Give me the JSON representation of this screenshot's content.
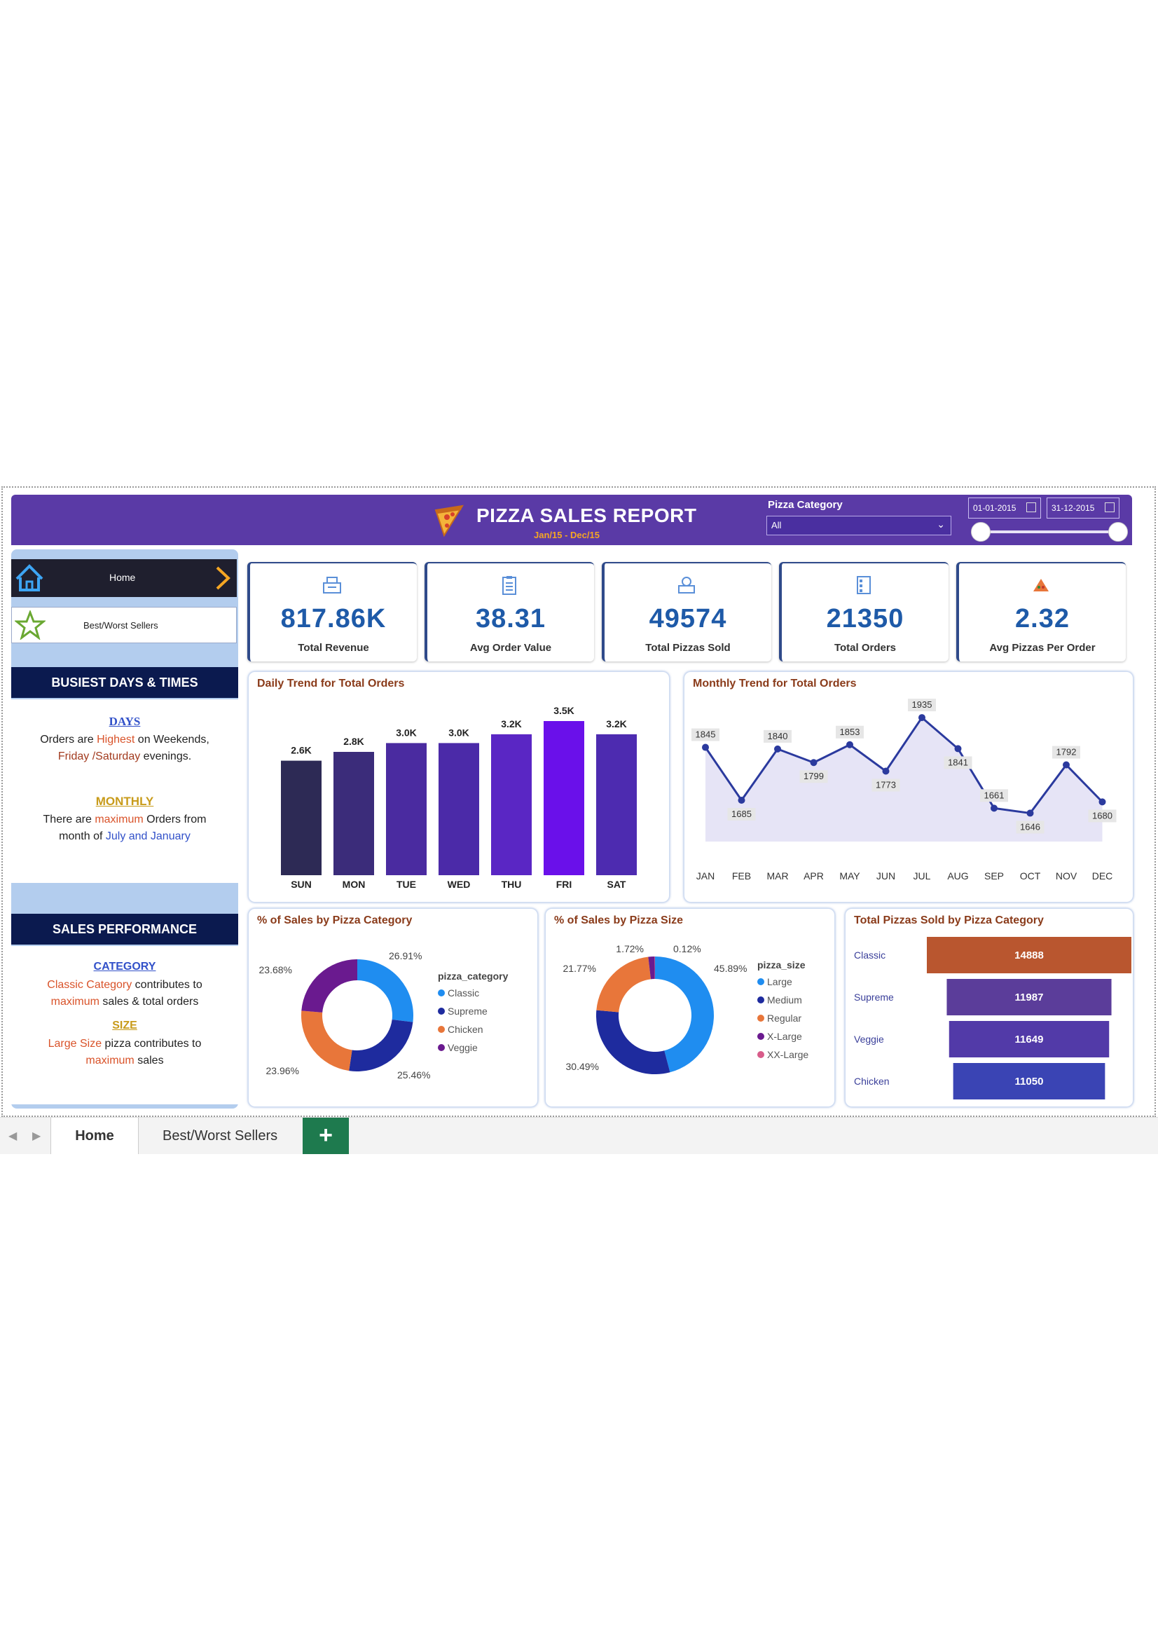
{
  "report": {
    "title": "PIZZA SALES REPORT",
    "subtitle": "Jan/15  -  Dec/15"
  },
  "filters": {
    "category_label": "Pizza Category",
    "category_value": "All",
    "start_date": "01-01-2015",
    "end_date": "31-12-2015"
  },
  "nav": {
    "home": "Home",
    "best_worst": "Best/Worst Sellers"
  },
  "busiest": {
    "heading": "BUSIEST DAYS & TIMES",
    "days_title": "DAYS",
    "days_l1a": "Orders are ",
    "days_l1b": "Highest",
    "days_l1c": " on  Weekends,",
    "days_l2a": "Friday /Saturday",
    "days_l2b": " evenings.",
    "monthly_title": "MONTHLY",
    "monthly_l1a": "There are ",
    "monthly_l1b": "maximum",
    "monthly_l1c": " Orders from",
    "monthly_l2a": "month of ",
    "monthly_l2b": "July and January"
  },
  "performance": {
    "heading": "SALES PERFORMANCE",
    "category_title": "CATEGORY",
    "cat_l1a": "Classic Category",
    "cat_l1b": " contributes to",
    "cat_l2a": "maximum",
    "cat_l2b": " sales & total orders",
    "size_title": "SIZE",
    "size_l1a": "Large Size",
    "size_l1b": " pizza contributes to",
    "size_l2": "maximum",
    "size_l2b": " sales"
  },
  "kpis": [
    {
      "value": "817.86K",
      "label": "Total Revenue"
    },
    {
      "value": "38.31",
      "label": "Avg Order Value"
    },
    {
      "value": "49574",
      "label": "Total Pizzas Sold"
    },
    {
      "value": "21350",
      "label": "Total Orders"
    },
    {
      "value": "2.32",
      "label": "Avg Pizzas Per Order"
    }
  ],
  "colors": {
    "header": "#5a3aa6",
    "accent_orange": "#f5a623",
    "kpi_value": "#1e5aa8",
    "panel_title": "#8a3b1a"
  },
  "chart_data": [
    {
      "type": "bar",
      "title": "Daily Trend for Total Orders",
      "categories": [
        "SUN",
        "MON",
        "TUE",
        "WED",
        "THU",
        "FRI",
        "SAT"
      ],
      "values": [
        2.6,
        2.8,
        3.0,
        3.0,
        3.2,
        3.5,
        3.2
      ],
      "data_labels": [
        "2.6K",
        "2.8K",
        "3.0K",
        "3.0K",
        "3.2K",
        "3.5K",
        "3.2K"
      ],
      "colors": [
        "#2d2a55",
        "#3b2c7a",
        "#4a2ba0",
        "#4b2aa8",
        "#5a26c4",
        "#6a10ea",
        "#4d2bb0"
      ],
      "ylim": [
        0,
        3.5
      ]
    },
    {
      "type": "area",
      "title": "Monthly Trend for Total Orders",
      "categories": [
        "JAN",
        "FEB",
        "MAR",
        "APR",
        "MAY",
        "JUN",
        "JUL",
        "AUG",
        "SEP",
        "OCT",
        "NOV",
        "DEC"
      ],
      "values": [
        1845,
        1685,
        1840,
        1799,
        1853,
        1773,
        1935,
        1841,
        1661,
        1646,
        1792,
        1680
      ],
      "ylim": [
        1560,
        1950
      ]
    },
    {
      "type": "pie",
      "title": "% of Sales by Pizza Category",
      "legend_title": "pizza_category",
      "labels": [
        "Classic",
        "Supreme",
        "Chicken",
        "Veggie"
      ],
      "values": [
        26.91,
        25.46,
        23.96,
        23.68
      ],
      "value_labels": [
        "26.91%",
        "25.46%",
        "23.96%",
        "23.68%"
      ],
      "colors": [
        "#1f8df0",
        "#1e2b9e",
        "#e8763a",
        "#6a1a8f"
      ]
    },
    {
      "type": "pie",
      "title": "% of Sales by Pizza Size",
      "legend_title": "pizza_size",
      "labels": [
        "Large",
        "Medium",
        "Regular",
        "X-Large",
        "XX-Large"
      ],
      "values": [
        45.89,
        30.49,
        21.77,
        1.72,
        0.12
      ],
      "value_labels": [
        "45.89%",
        "30.49%",
        "21.77%",
        "1.72%",
        "0.12%"
      ],
      "colors": [
        "#1f8df0",
        "#1e2b9e",
        "#e8763a",
        "#6a1a8f",
        "#d85c8a"
      ]
    },
    {
      "type": "bar",
      "title": "Total Pizzas Sold by Pizza Category",
      "categories": [
        "Classic",
        "Supreme",
        "Veggie",
        "Chicken"
      ],
      "values": [
        14888,
        11987,
        11649,
        11050
      ],
      "colors": [
        "#b9562f",
        "#5b3d9a",
        "#523aa8",
        "#3a44b4"
      ],
      "xlim": [
        0,
        14888
      ]
    }
  ],
  "tabs": {
    "home": "Home",
    "best_worst": "Best/Worst Sellers",
    "add": "+"
  }
}
